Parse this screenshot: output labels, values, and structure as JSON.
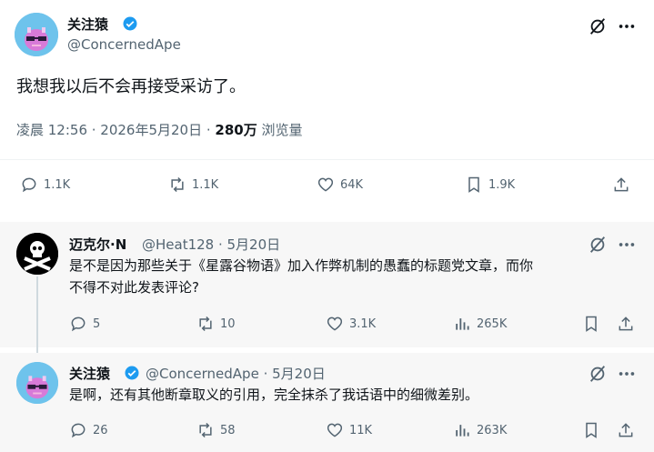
{
  "main_post": {
    "name": "关注猿",
    "handle": "@ConcernedApe",
    "text": "我想我以后不会再接受采访了。",
    "time": "凌晨 12:56 · 2026年5月20日 · ",
    "views_count": "280万",
    "views_label": " 浏览量",
    "actions": {
      "replies": "1.1K",
      "reposts": "1.1K",
      "likes": "64K",
      "bookmarks": "1.9K"
    }
  },
  "reply1": {
    "name": "迈克尔·N",
    "handle": "@Heat128 · 5月20日",
    "text_line1": "是不是因为那些关于《星露谷物语》加入作弊机制的愚蠢的标题党文章，而你",
    "text_line2": "不得不对此发表评论?",
    "actions": {
      "replies": "5",
      "reposts": "10",
      "likes": "3.1K",
      "views": "265K"
    }
  },
  "reply2": {
    "name": "关注猿",
    "handle": "@ConcernedApe · 5月20日",
    "text": "是啊，还有其他断章取义的引用，完全抹杀了我话语中的细微差别。",
    "actions": {
      "replies": "26",
      "reposts": "58",
      "likes": "11K",
      "views": "263K"
    }
  },
  "colors": {
    "verified": "#1d9bf0",
    "avatar_bg": "#6ec3ec",
    "text": "#0f1419",
    "muted": "#536471"
  }
}
